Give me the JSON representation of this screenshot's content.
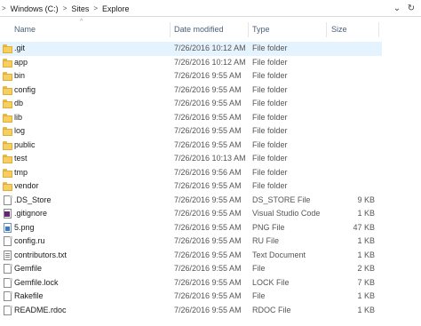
{
  "address_bar": {
    "breadcrumbs": [
      "Windows (C:)",
      "Sites",
      "Explore"
    ],
    "separator": ">",
    "dropdown_glyph": "⌄",
    "refresh_glyph": "↻"
  },
  "columns": {
    "name": "Name",
    "date": "Date modified",
    "type": "Type",
    "size": "Size",
    "sort_indicator": "^"
  },
  "files": [
    {
      "name": ".git",
      "date": "7/26/2016 10:12 AM",
      "type": "File folder",
      "size": "",
      "icon": "folder-icon",
      "selected": true
    },
    {
      "name": "app",
      "date": "7/26/2016 10:12 AM",
      "type": "File folder",
      "size": "",
      "icon": "folder-icon"
    },
    {
      "name": "bin",
      "date": "7/26/2016 9:55 AM",
      "type": "File folder",
      "size": "",
      "icon": "folder-icon"
    },
    {
      "name": "config",
      "date": "7/26/2016 9:55 AM",
      "type": "File folder",
      "size": "",
      "icon": "folder-icon"
    },
    {
      "name": "db",
      "date": "7/26/2016 9:55 AM",
      "type": "File folder",
      "size": "",
      "icon": "folder-icon"
    },
    {
      "name": "lib",
      "date": "7/26/2016 9:55 AM",
      "type": "File folder",
      "size": "",
      "icon": "folder-icon"
    },
    {
      "name": "log",
      "date": "7/26/2016 9:55 AM",
      "type": "File folder",
      "size": "",
      "icon": "folder-icon"
    },
    {
      "name": "public",
      "date": "7/26/2016 9:55 AM",
      "type": "File folder",
      "size": "",
      "icon": "folder-icon"
    },
    {
      "name": "test",
      "date": "7/26/2016 10:13 AM",
      "type": "File folder",
      "size": "",
      "icon": "folder-icon"
    },
    {
      "name": "tmp",
      "date": "7/26/2016 9:56 AM",
      "type": "File folder",
      "size": "",
      "icon": "folder-icon"
    },
    {
      "name": "vendor",
      "date": "7/26/2016 9:55 AM",
      "type": "File folder",
      "size": "",
      "icon": "folder-icon"
    },
    {
      "name": ".DS_Store",
      "date": "7/26/2016 9:55 AM",
      "type": "DS_STORE File",
      "size": "9 KB",
      "icon": "file-icon"
    },
    {
      "name": ".gitignore",
      "date": "7/26/2016 9:55 AM",
      "type": "Visual Studio Code",
      "size": "1 KB",
      "icon": "vscode-file-icon"
    },
    {
      "name": "5.png",
      "date": "7/26/2016 9:55 AM",
      "type": "PNG File",
      "size": "47 KB",
      "icon": "image-file-icon"
    },
    {
      "name": "config.ru",
      "date": "7/26/2016 9:55 AM",
      "type": "RU File",
      "size": "1 KB",
      "icon": "file-icon"
    },
    {
      "name": "contributors.txt",
      "date": "7/26/2016 9:55 AM",
      "type": "Text Document",
      "size": "1 KB",
      "icon": "text-file-icon"
    },
    {
      "name": "Gemfile",
      "date": "7/26/2016 9:55 AM",
      "type": "File",
      "size": "2 KB",
      "icon": "file-icon"
    },
    {
      "name": "Gemfile.lock",
      "date": "7/26/2016 9:55 AM",
      "type": "LOCK File",
      "size": "7 KB",
      "icon": "file-icon"
    },
    {
      "name": "Rakefile",
      "date": "7/26/2016 9:55 AM",
      "type": "File",
      "size": "1 KB",
      "icon": "file-icon"
    },
    {
      "name": "README.rdoc",
      "date": "7/26/2016 9:55 AM",
      "type": "RDOC File",
      "size": "1 KB",
      "icon": "file-icon"
    }
  ],
  "colors": {
    "selection": "#e5f3ff",
    "header_text": "#4c607a",
    "folder": "#f6cf5e"
  }
}
